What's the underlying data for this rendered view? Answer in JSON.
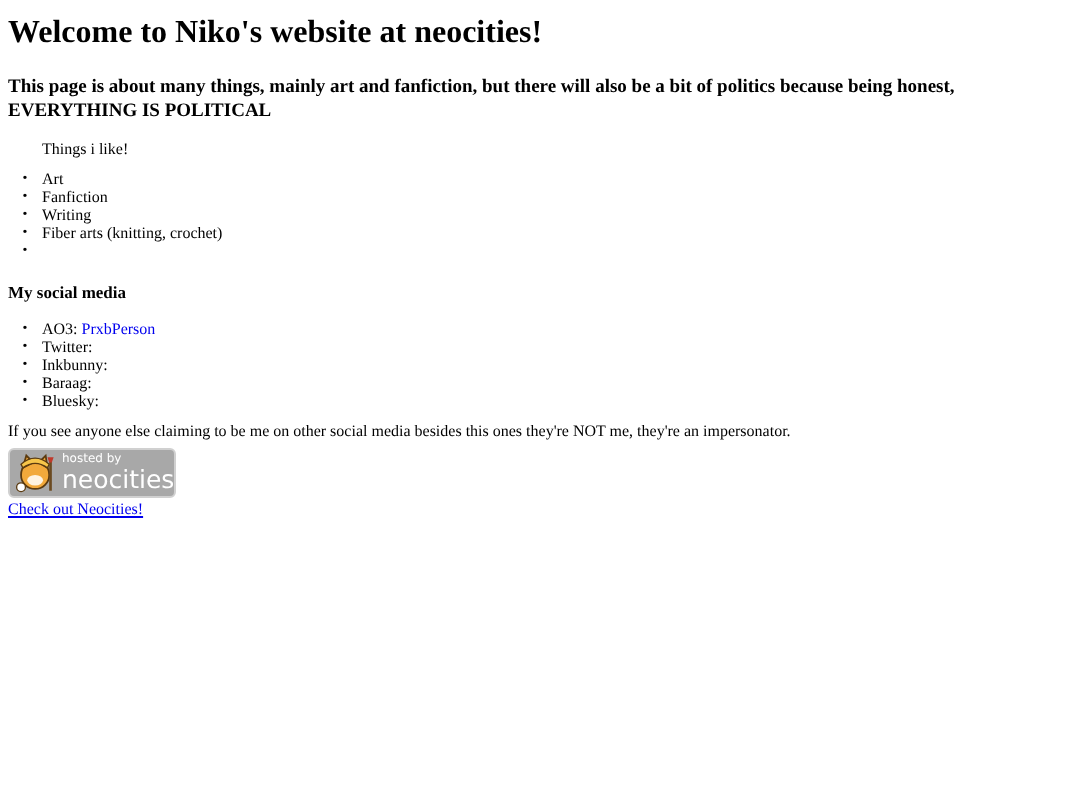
{
  "title": "Welcome to Niko's website at neocities!",
  "intro": "This page is about many things, mainly art and fanfiction, but there will also be a bit of politics because being honest, EVERYTHING IS POLITICAL",
  "likes": {
    "heading": "Things i like!",
    "items": [
      {
        "marker": "•",
        "text": "Art"
      },
      {
        "marker": "•",
        "text": "Fanfiction"
      },
      {
        "marker": "•",
        "text": "Writing"
      },
      {
        "marker": "•",
        "text": "Fiber arts (knitting, crochet)"
      },
      {
        "marker": "•"
      }
    ]
  },
  "social": {
    "heading": "My social media",
    "items": [
      {
        "marker": "•",
        "label": "AO3:",
        "link": "PrxbPerson"
      },
      {
        "marker": "•",
        "label": "Twitter:"
      },
      {
        "marker": "•",
        "label": "Inkbunny:"
      },
      {
        "marker": "•",
        "label": "Baraag:"
      },
      {
        "marker": "•",
        "label": "Bluesky:"
      }
    ]
  },
  "warning": "If you see anyone else claiming to be me on other social media besides this ones they're NOT me, they're an impersonator.",
  "badge": {
    "small": "hosted by",
    "big": "neocities"
  },
  "footer_link": "Check out Neocities!"
}
